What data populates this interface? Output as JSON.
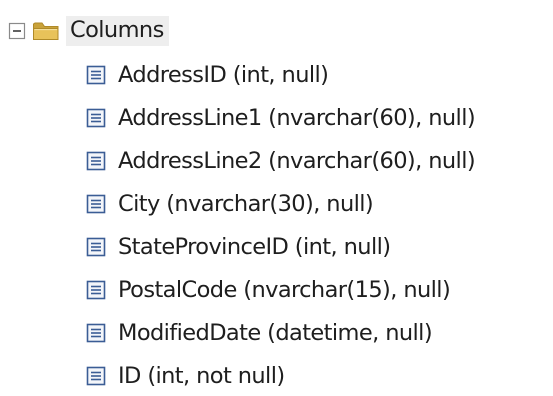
{
  "tree": {
    "root": {
      "label": "Columns",
      "expanded": true,
      "expander_icon": "collapse-minus-icon",
      "icon": "folder-icon"
    },
    "column_icon": "column-icon",
    "items": [
      {
        "label": "AddressID (int, null)"
      },
      {
        "label": "AddressLine1 (nvarchar(60), null)"
      },
      {
        "label": "AddressLine2 (nvarchar(60), null)"
      },
      {
        "label": "City (nvarchar(30), null)"
      },
      {
        "label": "StateProvinceID (int, null)"
      },
      {
        "label": "PostalCode (nvarchar(15), null)"
      },
      {
        "label": "ModifiedDate (datetime, null)"
      },
      {
        "label": "ID (int, not null)"
      }
    ],
    "colors": {
      "folder_yellow": "#e8c25a",
      "folder_dark": "#c9a23a",
      "column_icon_blue": "#3b5d95",
      "expander_border": "#8a8a8a",
      "selection_bg": "#eeeeee"
    }
  }
}
